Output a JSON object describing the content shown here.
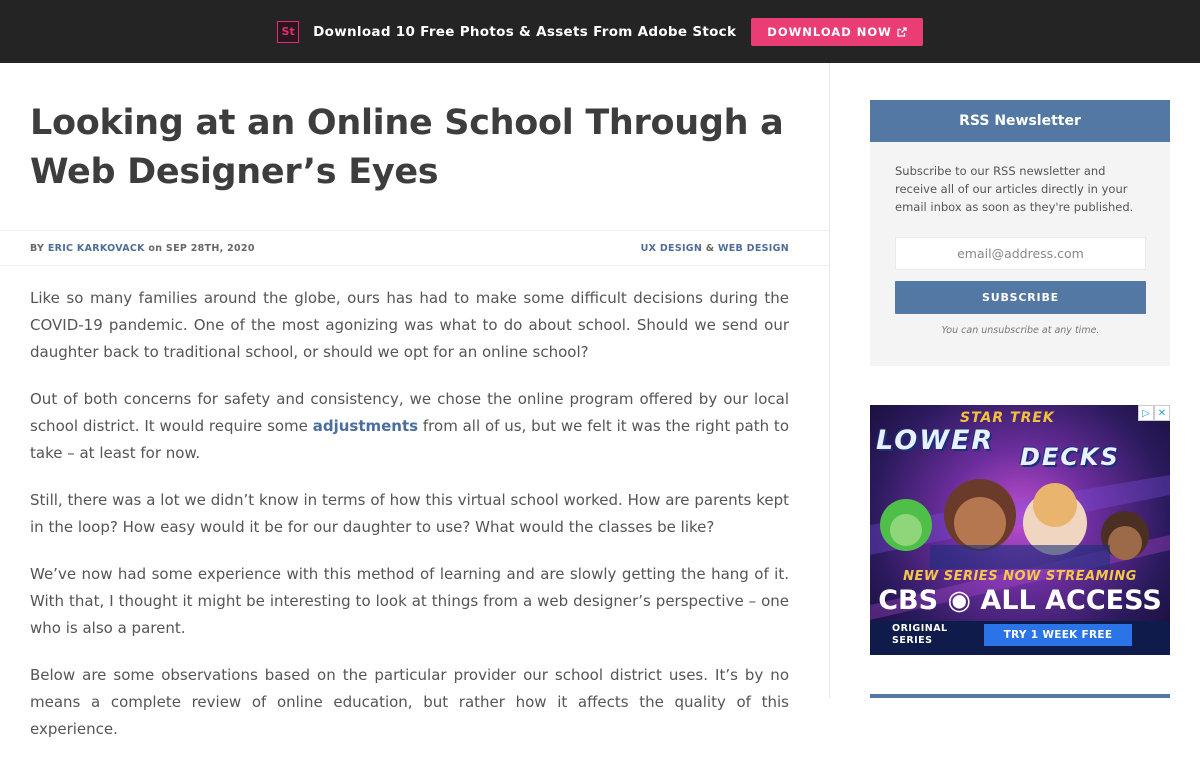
{
  "promo": {
    "logo_text": "St",
    "text": "Download 10 Free Photos & Assets From Adobe Stock",
    "button_label": "DOWNLOAD NOW",
    "accent": "#ea3d74"
  },
  "article": {
    "title": "Looking at an Online School Through a Web Designer’s Eyes",
    "meta": {
      "by": "BY",
      "author": "ERIC KARKOVACK",
      "on": "on",
      "date": "SEP 28TH, 2020",
      "category_1": "UX DESIGN",
      "amp": "&",
      "category_2": "WEB DESIGN"
    },
    "paragraphs": {
      "p1": "Like so many families around the globe, ours has had to make some difficult decisions during the COVID-19 pandemic. One of the most agonizing was what to do about school. Should we send our daughter back to traditional school, or should we opt for an online school?",
      "p2_before": "Out of both concerns for safety and consistency, we chose the online program offered by our local school district. It would require some ",
      "p2_link": "adjustments",
      "p2_after": " from all of us, but we felt it was the right path to take – at least for now.",
      "p3": "Still, there was a lot we didn’t know in terms of how this virtual school worked. How are parents kept in the loop? How easy would it be for our daughter to use? What would the classes be like?",
      "p4": "We’ve now had some experience with this method of learning and are slowly getting the hang of it. With that, I thought it might be interesting to look at things from a web designer’s perspective – one who is also a parent.",
      "p5": "Below are some observations based on the particular provider our school district uses. It’s by no means a complete review of online education, but rather how it affects the quality of this experience."
    }
  },
  "newsletter": {
    "heading": "RSS Newsletter",
    "description": "Subscribe to our RSS newsletter and receive all of our articles directly in your email inbox as soon as they're published.",
    "email_placeholder": "email@address.com",
    "subscribe_label": "SUBSCRIBE",
    "unsubscribe_note": "You can unsubscribe at any time.",
    "header_color": "#5478a4"
  },
  "ad": {
    "star_trek": "STAR TREK",
    "lower": "LOWER",
    "decks": "DECKS",
    "new_series": "NEW SERIES NOW STREAMING",
    "cbs": "CBS ◉ ALL ACCESS",
    "original_line1": "ORIGINAL",
    "original_line2": "SERIES",
    "try_button": "TRY 1 WEEK FREE"
  }
}
